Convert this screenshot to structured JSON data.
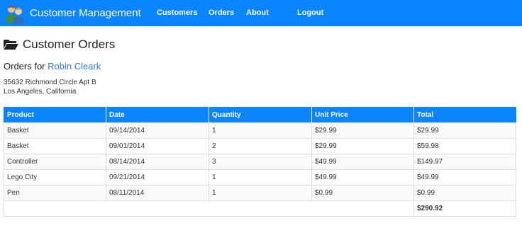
{
  "app": {
    "title": "Customer Management",
    "logo_icon": "users-icon"
  },
  "nav": {
    "customers": "Customers",
    "orders": "Orders",
    "about": "About",
    "logout": "Logout"
  },
  "page": {
    "title": "Customer Orders",
    "title_icon": "folder-open-icon",
    "orders_for_label": "Orders for",
    "customer_name": "Robin Cleark",
    "address_line1": "35632 Richmond Circle Apt B",
    "address_line2": "Los Angeles, California"
  },
  "table": {
    "headers": [
      "Product",
      "Date",
      "Quantity",
      "Unit Price",
      "Total"
    ],
    "rows": [
      [
        "Basket",
        "09/14/2014",
        "1",
        "$29.99",
        "$29.99"
      ],
      [
        "Basket",
        "09/01/2014",
        "2",
        "$29.99",
        "$59.98"
      ],
      [
        "Controller",
        "08/14/2014",
        "3",
        "$49.99",
        "$149.97"
      ],
      [
        "Lego City",
        "09/21/2014",
        "1",
        "$49.99",
        "$49.99"
      ],
      [
        "Pen",
        "08/11/2014",
        "1",
        "$0.99",
        "$0.99"
      ]
    ],
    "grand_total": "$290.92"
  },
  "colors": {
    "accent": "#0a84ff",
    "link": "#2a7fd4"
  }
}
